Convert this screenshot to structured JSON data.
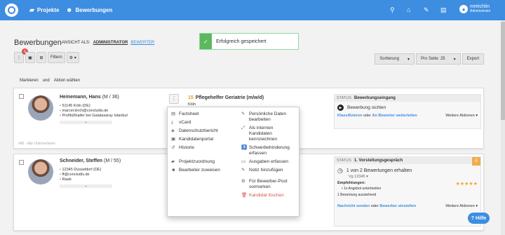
{
  "nav": {
    "projekte": "Projekte",
    "bewerbungen": "Bewerbungen"
  },
  "user": {
    "name": "mreichlin",
    "role": "Administrator"
  },
  "page": {
    "title": "Bewerbungen",
    "view_as_label": "ANSICHT ALS:",
    "view_admin": "ADMINISTRATOR",
    "view_bewerter": "BEWERTER"
  },
  "toast": {
    "message": "Erfolgreich gespeichert"
  },
  "toolbar": {
    "badge": "6",
    "filter": "Filtern"
  },
  "right_tools": {
    "sort": "Sortierung",
    "per_page": "Pro Seite: 25",
    "export": "Export"
  },
  "bulk": {
    "markieren": "Markieren",
    "und": "und",
    "aktion": "Aktion wählen"
  },
  "cards": [
    {
      "name": "Heinemann, Hans",
      "meta": "(M / 36)",
      "info": [
        "51145 Köln (DE)",
        "marcel.kirch@concludis.de",
        "Profilüßhaller bei Galatasaray Istanbul"
      ],
      "job_num": "15",
      "job": "Pflegehelfer Geriatrie (m/w/d)",
      "job_loc": "Köln",
      "status_label": "STATUS",
      "status": "Bewerbungseingang",
      "action": "Bewerbung sichten",
      "link1": "Klassifizieren",
      "oder": "oder",
      "link2": "An Bewerter weiterleiten",
      "more": "Weitere Aktionen",
      "footer": "Alle Unternehmen"
    },
    {
      "name": "Schneider, Steffen",
      "meta": "(M / 55)",
      "info": [
        "12345 Düsseldorf (DE)",
        "ff@concludis.de",
        "Raab"
      ],
      "status_label": "STATUS",
      "status": "1. Vorstellungsgespräch",
      "status_badge": "A",
      "action": "1 von 2 Bewertungen erhalten",
      "sub": "Vg 12345",
      "emp_label": "Empfehlungen:",
      "emp_item": "1x Angebot unterbreiten",
      "pending": "1 Bewertung ausstehend",
      "rating": 5,
      "link1": "Nachricht senden",
      "oder": "oder",
      "link2": "Bewerber einstellen",
      "more": "Weitere Aktionen"
    }
  ],
  "menu": {
    "left": [
      "Factsheet",
      "vCard",
      "Datenschutzbericht",
      "Kandidatenportal",
      "Historie",
      "Projektzuordnung",
      "Bearbeiter zuweisen"
    ],
    "right": [
      "Persönliche Daten bearbeiten",
      "Als internen Kandidaten kennzeichnen",
      "Schwerbehinderung erfassen",
      "Ausgaben erfassen",
      "Notiz hinzufügen",
      "Für Bewerber-Pool vormerken",
      "Kandidat löschen"
    ]
  },
  "help": "Hilfe"
}
